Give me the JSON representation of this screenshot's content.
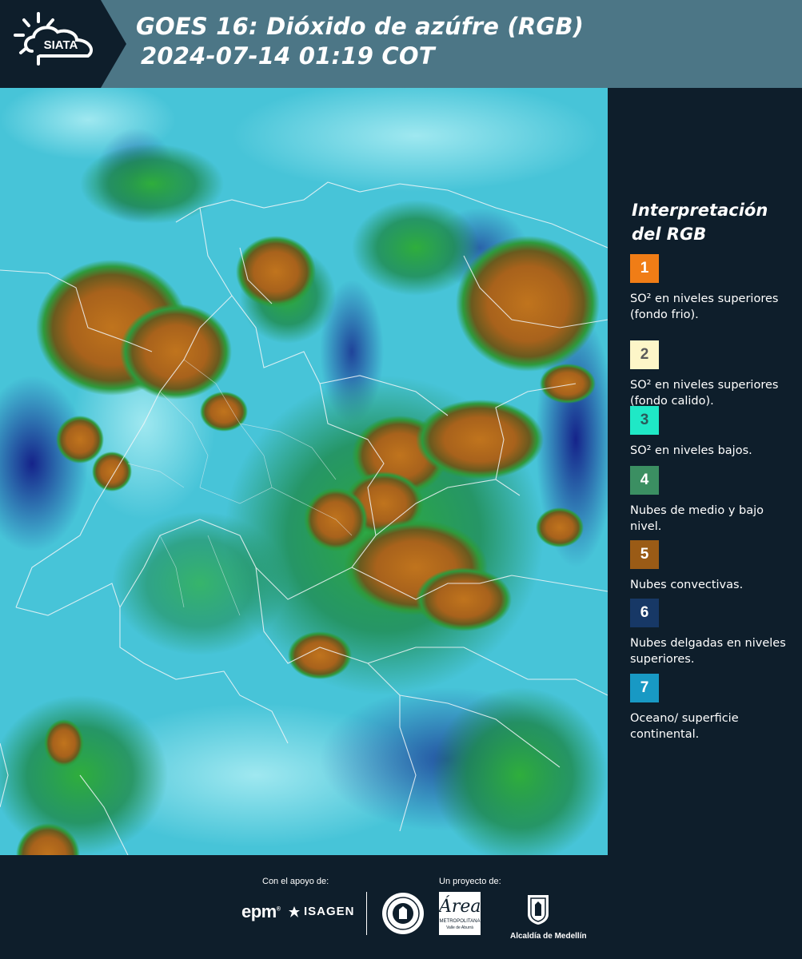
{
  "header": {
    "logo_text": "SIATA",
    "title_line1": "GOES 16: Dióxido de azúfre (RGB)",
    "title_line2": "2024-07-14 01:19 COT"
  },
  "legend": {
    "title_line1": "Interpretación",
    "title_line2": "del RGB",
    "items": [
      {
        "number": "1",
        "color": "#f07d16",
        "number_color": "#ffffff",
        "text": "SO² en niveles superiores (fondo frio)."
      },
      {
        "number": "2",
        "color": "#fdf6c8",
        "number_color": "#5a5a5a",
        "text": "SO² en niveles superiores (fondo calido)."
      },
      {
        "number": "3",
        "color": "#1fe8c6",
        "number_color": "#2a5a5a",
        "text": "SO² en niveles bajos."
      },
      {
        "number": "4",
        "color": "#3b8f62",
        "number_color": "#ffffff",
        "text": "Nubes de medio y bajo nivel."
      },
      {
        "number": "5",
        "color": "#9a5b16",
        "number_color": "#ffffff",
        "text": "Nubes convectivas."
      },
      {
        "number": "6",
        "color": "#173866",
        "number_color": "#ffffff",
        "text": "Nubes delgadas en niveles superiores."
      },
      {
        "number": "7",
        "color": "#1899c4",
        "number_color": "#ffffff",
        "text": "Oceano/ superficie continental."
      }
    ]
  },
  "footer": {
    "support_label": "Con el apoyo de:",
    "project_label": "Un proyecto de:",
    "epm": "epm",
    "isagen": "ISAGEN",
    "area_main": "Área",
    "area_line1": "METROPOLITANA",
    "area_line2": "Valle de Aburrá",
    "alcaldia": "Alcaldía de Medellín"
  }
}
